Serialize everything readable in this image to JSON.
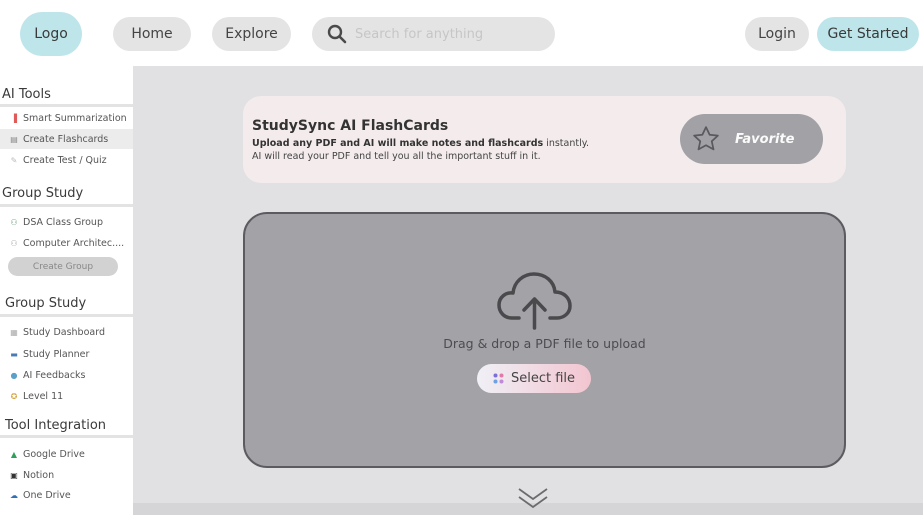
{
  "header": {
    "logo": "Logo",
    "nav": {
      "home": "Home",
      "explore": "Explore"
    },
    "search": {
      "placeholder": "Search for anything"
    },
    "login": "Login",
    "get_started": "Get Started"
  },
  "sidebar": {
    "sections": [
      {
        "title": "AI Tools",
        "items": [
          {
            "label": "Smart Summarization",
            "icon": "document-icon"
          },
          {
            "label": "Create Flashcards",
            "icon": "cards-icon",
            "active": true
          },
          {
            "label": "Create Test / Quiz",
            "icon": "quiz-icon"
          }
        ]
      },
      {
        "title": "Group Study",
        "items": [
          {
            "label": "DSA Class Group",
            "icon": "group-icon"
          },
          {
            "label": "Computer Architec....",
            "icon": "group-icon"
          }
        ],
        "button": "Create Group"
      },
      {
        "title": "Group Study",
        "items": [
          {
            "label": "Study Dashboard",
            "icon": "dashboard-icon"
          },
          {
            "label": "Study Planner",
            "icon": "planner-icon"
          },
          {
            "label": "AI Feedbacks",
            "icon": "feedback-icon"
          },
          {
            "label": "Level 11",
            "icon": "badge-icon"
          }
        ]
      },
      {
        "title": "Tool Integration",
        "items": [
          {
            "label": "Google Drive",
            "icon": "google-drive-icon"
          },
          {
            "label": "Notion",
            "icon": "notion-icon"
          },
          {
            "label": "One Drive",
            "icon": "onedrive-icon"
          }
        ]
      }
    ]
  },
  "main": {
    "banner": {
      "title": "StudySync AI FlashCards",
      "desc_bold": "Upload any PDF and AI will make notes and flashcards",
      "desc_rest": " instantly. AI will read your PDF and tell you all the important stuff in it.",
      "favorite": "Favorite"
    },
    "upload": {
      "prompt": "Drag & drop a PDF file to upload",
      "select": "Select file"
    }
  },
  "colors": {
    "accent": "#bde5ea",
    "pill_gray": "#e4e4e4",
    "main_bg": "#e1e1e3",
    "drop_bg": "#a2a2a7",
    "banner_bg": "#f3ebec"
  }
}
